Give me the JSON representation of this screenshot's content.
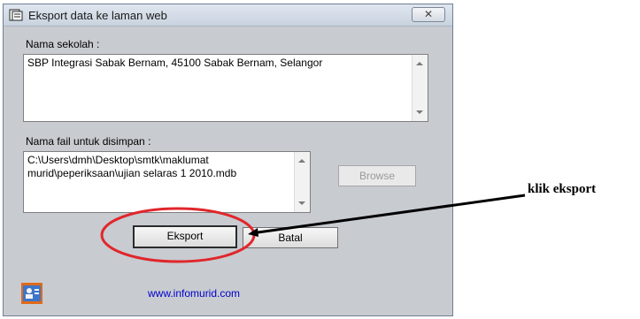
{
  "window": {
    "title": "Eksport data ke laman web",
    "close_label": "✕"
  },
  "school": {
    "label": "Nama sekolah :",
    "value": "SBP Integrasi Sabak Bernam, 45100 Sabak Bernam, Selangor"
  },
  "file": {
    "label": "Nama fail untuk disimpan :",
    "value": "C:\\Users\\dmh\\Desktop\\smtk\\maklumat murid\\peperiksaan\\ujian selaras 1 2010.mdb",
    "browse_label": "Browse"
  },
  "buttons": {
    "export_label": "Eksport",
    "cancel_label": "Batal"
  },
  "footer": {
    "link_text": "www.infomurid.com"
  },
  "annotation": {
    "text": "klik eksport",
    "color": "#e0262b"
  },
  "icons": {
    "app": "database-icon",
    "close": "close-icon",
    "footer": "user-card-icon"
  }
}
